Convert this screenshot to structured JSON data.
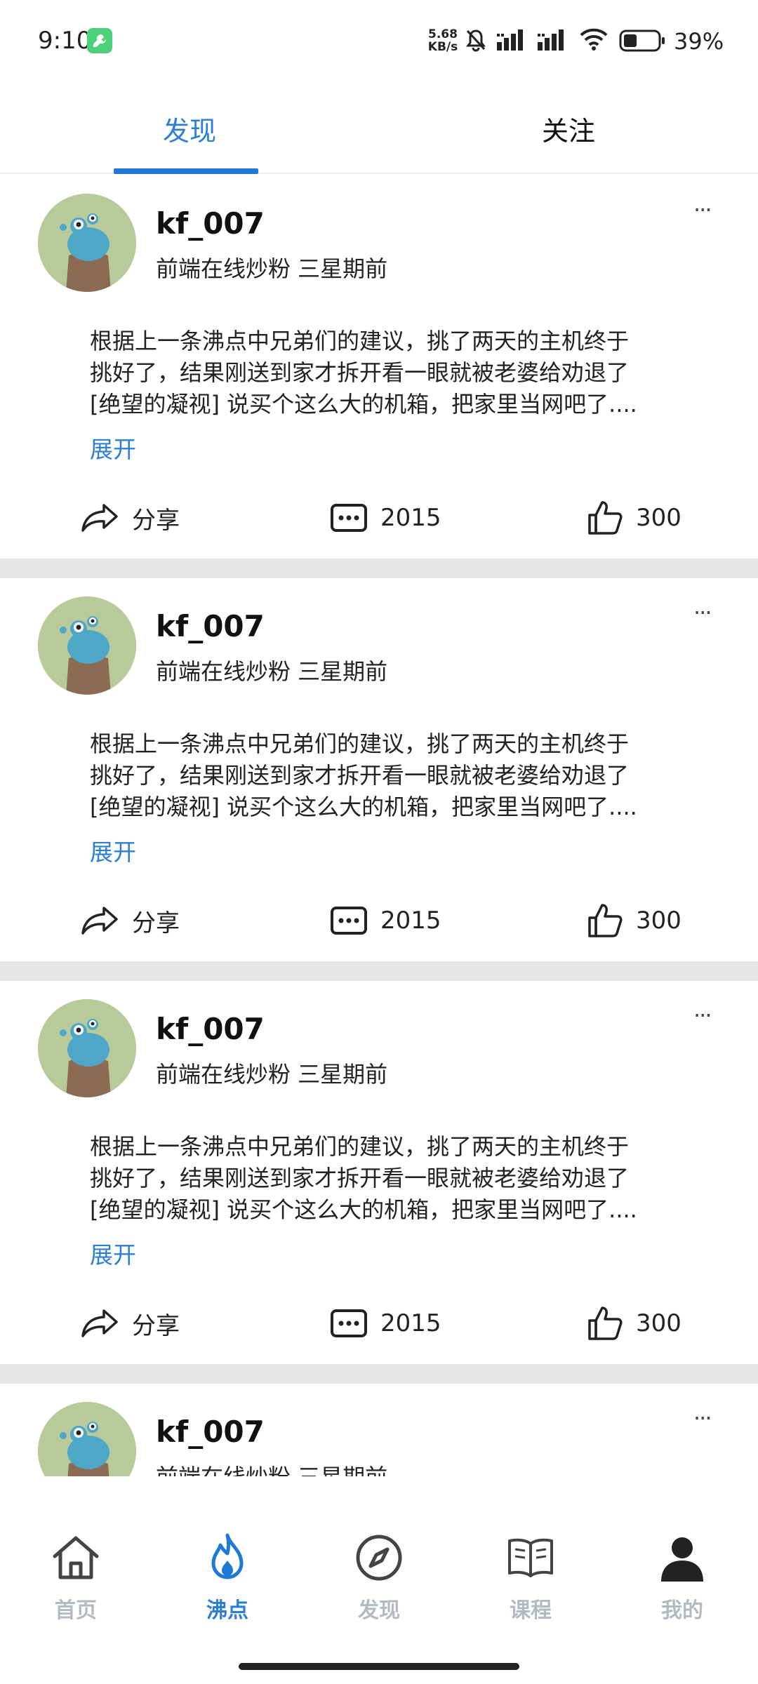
{
  "status_bar": {
    "time": "9:10",
    "net_speed_value": "5.68",
    "net_speed_unit": "KB/s",
    "battery_percent": "39%",
    "icons": [
      "tool-badge-icon",
      "mute-icon",
      "signal-icon",
      "signal-icon",
      "wifi-icon",
      "battery-icon"
    ]
  },
  "top_tabs": [
    {
      "label": "发现",
      "active": true
    },
    {
      "label": "关注",
      "active": false
    }
  ],
  "posts": [
    {
      "username": "kf_007",
      "subtitle": "前端在线炒粉 三星期前",
      "more": "···",
      "content_line1": "根据上一条沸点中兄弟们的建议，挑了两天的主机终于",
      "content_line2": "挑好了，结果刚送到家才拆开看一眼就被老婆给劝退了",
      "content_line3": "[绝望的凝视] 说买个这么大的机箱，把家里当网吧了....",
      "expand": "展开",
      "share_label": "分享",
      "comment_count": "2015",
      "like_count": "300"
    },
    {
      "username": "kf_007",
      "subtitle": "前端在线炒粉 三星期前",
      "more": "···",
      "content_line1": "根据上一条沸点中兄弟们的建议，挑了两天的主机终于",
      "content_line2": "挑好了，结果刚送到家才拆开看一眼就被老婆给劝退了",
      "content_line3": "[绝望的凝视] 说买个这么大的机箱，把家里当网吧了....",
      "expand": "展开",
      "share_label": "分享",
      "comment_count": "2015",
      "like_count": "300"
    },
    {
      "username": "kf_007",
      "subtitle": "前端在线炒粉 三星期前",
      "more": "···",
      "content_line1": "根据上一条沸点中兄弟们的建议，挑了两天的主机终于",
      "content_line2": "挑好了，结果刚送到家才拆开看一眼就被老婆给劝退了",
      "content_line3": "[绝望的凝视] 说买个这么大的机箱，把家里当网吧了....",
      "expand": "展开",
      "share_label": "分享",
      "comment_count": "2015",
      "like_count": "300"
    },
    {
      "username": "kf_007",
      "subtitle": "前端在线炒粉 三星期前",
      "more": "···"
    }
  ],
  "bottom_nav": [
    {
      "label": "首页",
      "icon": "home-icon",
      "active": false
    },
    {
      "label": "沸点",
      "icon": "flame-icon",
      "active": true
    },
    {
      "label": "发现",
      "icon": "compass-icon",
      "active": false
    },
    {
      "label": "课程",
      "icon": "book-icon",
      "active": false
    },
    {
      "label": "我的",
      "icon": "profile-icon",
      "active": false
    }
  ],
  "colors": {
    "accent": "#2d7fd3",
    "nav_inactive": "#b4bac2",
    "separator": "#e6e6e6"
  }
}
